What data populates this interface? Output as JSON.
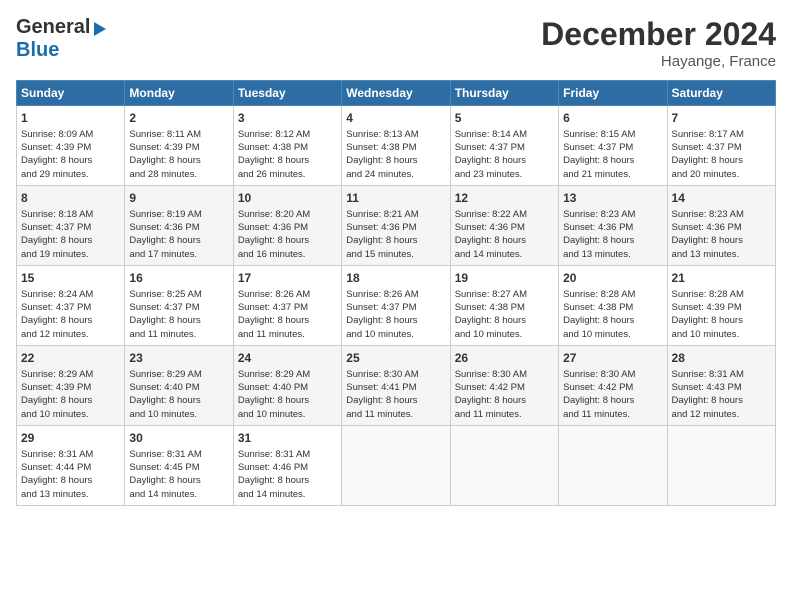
{
  "title": "December 2024",
  "subtitle": "Hayange, France",
  "logo": {
    "line1": "General",
    "line2": "Blue"
  },
  "days_of_week": [
    "Sunday",
    "Monday",
    "Tuesday",
    "Wednesday",
    "Thursday",
    "Friday",
    "Saturday"
  ],
  "weeks": [
    [
      {
        "day": "1",
        "lines": [
          "Sunrise: 8:09 AM",
          "Sunset: 4:39 PM",
          "Daylight: 8 hours",
          "and 29 minutes."
        ]
      },
      {
        "day": "2",
        "lines": [
          "Sunrise: 8:11 AM",
          "Sunset: 4:39 PM",
          "Daylight: 8 hours",
          "and 28 minutes."
        ]
      },
      {
        "day": "3",
        "lines": [
          "Sunrise: 8:12 AM",
          "Sunset: 4:38 PM",
          "Daylight: 8 hours",
          "and 26 minutes."
        ]
      },
      {
        "day": "4",
        "lines": [
          "Sunrise: 8:13 AM",
          "Sunset: 4:38 PM",
          "Daylight: 8 hours",
          "and 24 minutes."
        ]
      },
      {
        "day": "5",
        "lines": [
          "Sunrise: 8:14 AM",
          "Sunset: 4:37 PM",
          "Daylight: 8 hours",
          "and 23 minutes."
        ]
      },
      {
        "day": "6",
        "lines": [
          "Sunrise: 8:15 AM",
          "Sunset: 4:37 PM",
          "Daylight: 8 hours",
          "and 21 minutes."
        ]
      },
      {
        "day": "7",
        "lines": [
          "Sunrise: 8:17 AM",
          "Sunset: 4:37 PM",
          "Daylight: 8 hours",
          "and 20 minutes."
        ]
      }
    ],
    [
      {
        "day": "8",
        "lines": [
          "Sunrise: 8:18 AM",
          "Sunset: 4:37 PM",
          "Daylight: 8 hours",
          "and 19 minutes."
        ]
      },
      {
        "day": "9",
        "lines": [
          "Sunrise: 8:19 AM",
          "Sunset: 4:36 PM",
          "Daylight: 8 hours",
          "and 17 minutes."
        ]
      },
      {
        "day": "10",
        "lines": [
          "Sunrise: 8:20 AM",
          "Sunset: 4:36 PM",
          "Daylight: 8 hours",
          "and 16 minutes."
        ]
      },
      {
        "day": "11",
        "lines": [
          "Sunrise: 8:21 AM",
          "Sunset: 4:36 PM",
          "Daylight: 8 hours",
          "and 15 minutes."
        ]
      },
      {
        "day": "12",
        "lines": [
          "Sunrise: 8:22 AM",
          "Sunset: 4:36 PM",
          "Daylight: 8 hours",
          "and 14 minutes."
        ]
      },
      {
        "day": "13",
        "lines": [
          "Sunrise: 8:23 AM",
          "Sunset: 4:36 PM",
          "Daylight: 8 hours",
          "and 13 minutes."
        ]
      },
      {
        "day": "14",
        "lines": [
          "Sunrise: 8:23 AM",
          "Sunset: 4:36 PM",
          "Daylight: 8 hours",
          "and 13 minutes."
        ]
      }
    ],
    [
      {
        "day": "15",
        "lines": [
          "Sunrise: 8:24 AM",
          "Sunset: 4:37 PM",
          "Daylight: 8 hours",
          "and 12 minutes."
        ]
      },
      {
        "day": "16",
        "lines": [
          "Sunrise: 8:25 AM",
          "Sunset: 4:37 PM",
          "Daylight: 8 hours",
          "and 11 minutes."
        ]
      },
      {
        "day": "17",
        "lines": [
          "Sunrise: 8:26 AM",
          "Sunset: 4:37 PM",
          "Daylight: 8 hours",
          "and 11 minutes."
        ]
      },
      {
        "day": "18",
        "lines": [
          "Sunrise: 8:26 AM",
          "Sunset: 4:37 PM",
          "Daylight: 8 hours",
          "and 10 minutes."
        ]
      },
      {
        "day": "19",
        "lines": [
          "Sunrise: 8:27 AM",
          "Sunset: 4:38 PM",
          "Daylight: 8 hours",
          "and 10 minutes."
        ]
      },
      {
        "day": "20",
        "lines": [
          "Sunrise: 8:28 AM",
          "Sunset: 4:38 PM",
          "Daylight: 8 hours",
          "and 10 minutes."
        ]
      },
      {
        "day": "21",
        "lines": [
          "Sunrise: 8:28 AM",
          "Sunset: 4:39 PM",
          "Daylight: 8 hours",
          "and 10 minutes."
        ]
      }
    ],
    [
      {
        "day": "22",
        "lines": [
          "Sunrise: 8:29 AM",
          "Sunset: 4:39 PM",
          "Daylight: 8 hours",
          "and 10 minutes."
        ]
      },
      {
        "day": "23",
        "lines": [
          "Sunrise: 8:29 AM",
          "Sunset: 4:40 PM",
          "Daylight: 8 hours",
          "and 10 minutes."
        ]
      },
      {
        "day": "24",
        "lines": [
          "Sunrise: 8:29 AM",
          "Sunset: 4:40 PM",
          "Daylight: 8 hours",
          "and 10 minutes."
        ]
      },
      {
        "day": "25",
        "lines": [
          "Sunrise: 8:30 AM",
          "Sunset: 4:41 PM",
          "Daylight: 8 hours",
          "and 11 minutes."
        ]
      },
      {
        "day": "26",
        "lines": [
          "Sunrise: 8:30 AM",
          "Sunset: 4:42 PM",
          "Daylight: 8 hours",
          "and 11 minutes."
        ]
      },
      {
        "day": "27",
        "lines": [
          "Sunrise: 8:30 AM",
          "Sunset: 4:42 PM",
          "Daylight: 8 hours",
          "and 11 minutes."
        ]
      },
      {
        "day": "28",
        "lines": [
          "Sunrise: 8:31 AM",
          "Sunset: 4:43 PM",
          "Daylight: 8 hours",
          "and 12 minutes."
        ]
      }
    ],
    [
      {
        "day": "29",
        "lines": [
          "Sunrise: 8:31 AM",
          "Sunset: 4:44 PM",
          "Daylight: 8 hours",
          "and 13 minutes."
        ]
      },
      {
        "day": "30",
        "lines": [
          "Sunrise: 8:31 AM",
          "Sunset: 4:45 PM",
          "Daylight: 8 hours",
          "and 14 minutes."
        ]
      },
      {
        "day": "31",
        "lines": [
          "Sunrise: 8:31 AM",
          "Sunset: 4:46 PM",
          "Daylight: 8 hours",
          "and 14 minutes."
        ]
      },
      null,
      null,
      null,
      null
    ]
  ]
}
